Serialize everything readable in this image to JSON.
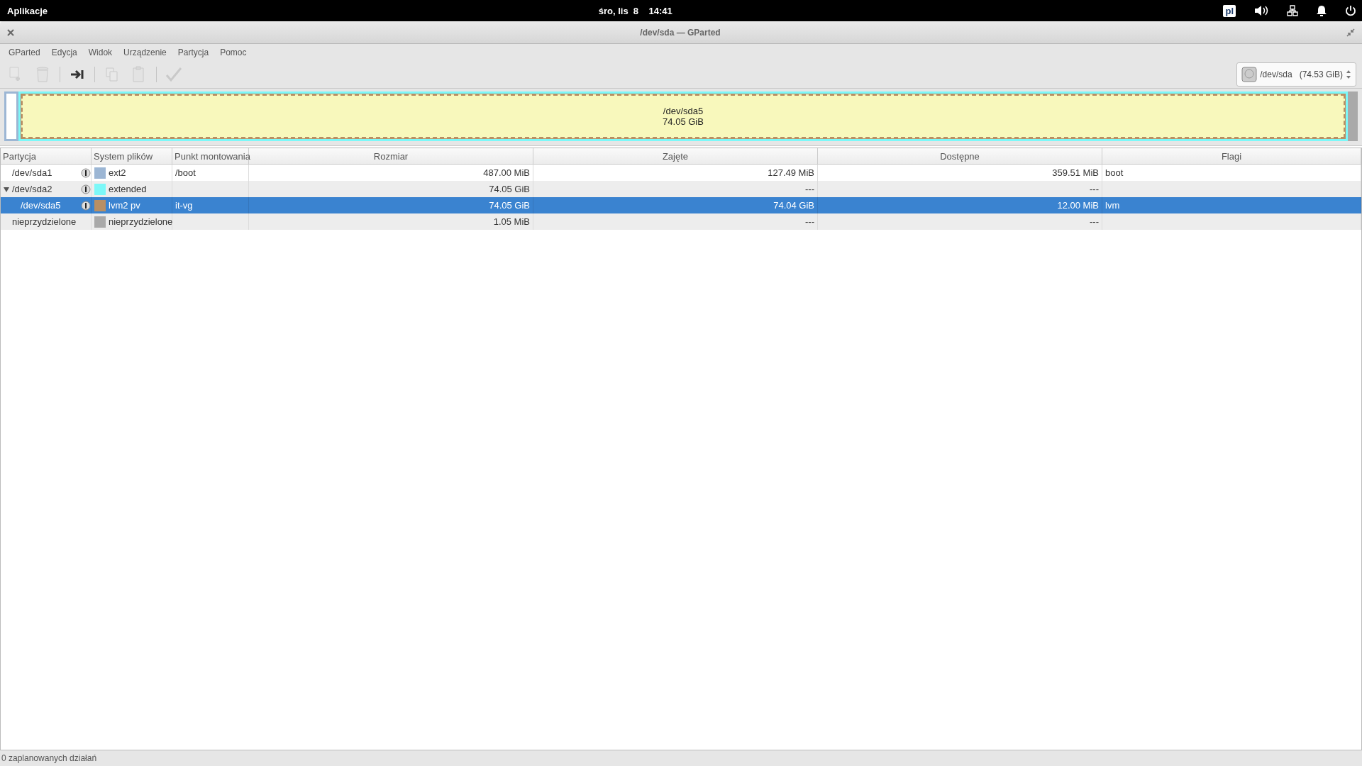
{
  "top_panel": {
    "apps": "Aplikacje",
    "clock": "śro, lis  8    14:41",
    "layout": "pl"
  },
  "window": {
    "title": "/dev/sda — GParted"
  },
  "menu": [
    "GParted",
    "Edycja",
    "Widok",
    "Urządzenie",
    "Partycja",
    "Pomoc"
  ],
  "toolbar": [
    {
      "kind": "new",
      "disabled": true
    },
    {
      "kind": "delete",
      "disabled": true
    },
    {
      "kind": "sep"
    },
    {
      "kind": "resize",
      "disabled": false
    },
    {
      "kind": "sep"
    },
    {
      "kind": "copy",
      "disabled": true
    },
    {
      "kind": "paste",
      "disabled": true
    },
    {
      "kind": "sep"
    },
    {
      "kind": "apply",
      "disabled": true
    }
  ],
  "device": {
    "name": "/dev/sda",
    "size": "(74.53 GiB)"
  },
  "disk_map": [
    {
      "kind": "primary",
      "color": "#9cb6d4",
      "selected": false
    },
    {
      "kind": "extended",
      "color": "#7cf8f8",
      "selected": false,
      "children": [
        {
          "kind": "lvm",
          "color": "#b88f64",
          "selected": true,
          "label": "/dev/sda5",
          "size": "74.05 GiB"
        }
      ]
    },
    {
      "kind": "unallocated",
      "color": "#a9a9a9",
      "selected": false
    }
  ],
  "columns": [
    "Partycja",
    "System plików",
    "Punkt montowania",
    "Rozmiar",
    "Zajęte",
    "Dostępne",
    "Flagi"
  ],
  "rows": [
    {
      "partition": "/dev/sda1",
      "mounted": true,
      "color": "#9cb6d4",
      "fs": "ext2",
      "mount": "/boot",
      "size": "487.00 MiB",
      "used": "127.49 MiB",
      "free": "359.51 MiB",
      "flags": "boot",
      "selected": false
    },
    {
      "partition": "/dev/sda2",
      "mounted": true,
      "color": "#7cf8f8",
      "fs": "extended",
      "size": "74.05 GiB",
      "used": "---",
      "free": "---",
      "selected": false,
      "expanded": true,
      "children": [
        {
          "partition": "/dev/sda5",
          "mounted": true,
          "color": "#b88f64",
          "fs": "lvm2 pv",
          "mount": "it-vg",
          "size": "74.05 GiB",
          "used": "74.04 GiB",
          "free": "12.00 MiB",
          "flags": "lvm",
          "selected": true
        }
      ]
    },
    {
      "partition": "nieprzydzielone",
      "mounted": false,
      "color": "#a9a9a9",
      "fs": "nieprzydzielone",
      "size": "1.05 MiB",
      "used": "---",
      "free": "---",
      "selected": false
    }
  ],
  "status_bar": "0 zaplanowanych działań"
}
